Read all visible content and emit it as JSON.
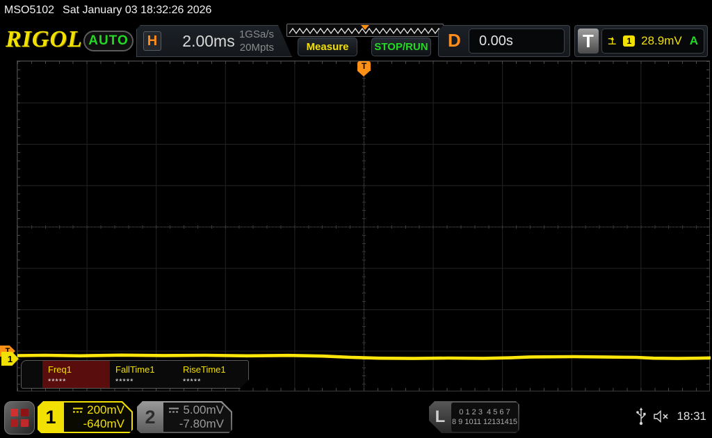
{
  "titlebar": {
    "model": "MSO5102",
    "datetime": "Sat January 03 18:32:26 2026"
  },
  "header": {
    "logo": "RIGOL",
    "auto_badge": "AUTO",
    "h_label": "H",
    "timebase": "2.00ms",
    "sample_rate": "1GSa/s",
    "mem_depth": "20Mpts",
    "measure_button": "Measure",
    "stoprun_button": "STOP/RUN",
    "d_label": "D",
    "delay": "0.00s",
    "t_label": "T",
    "trigger_channel": "1",
    "trigger_level": "28.9mV",
    "trigger_mode": "A"
  },
  "graticule": {
    "trigger_pos_marker": "T",
    "trigger_level_marker": "T",
    "channel1_marker": "1"
  },
  "measurements": {
    "items": [
      {
        "label": "Freq1",
        "value": "*****"
      },
      {
        "label": "FallTime1",
        "value": "*****"
      },
      {
        "label": "RiseTime1",
        "value": "*****"
      }
    ]
  },
  "bottombar": {
    "ch1": {
      "number": "1",
      "scale": "200mV",
      "offset": "-640mV"
    },
    "ch2": {
      "number": "2",
      "scale": "5.00mV",
      "offset": "-7.80mV"
    },
    "logic": {
      "label": "L",
      "row1": "0 1 2 3  4 5 6 7",
      "row2": "8 9 1011 12131415"
    },
    "clock": "18:31"
  },
  "colors": {
    "channel1_yellow": "#f2e003",
    "trace_yellow": "#ffe60a",
    "accent_orange": "#ff8d1e",
    "status_green": "#25d825",
    "selected_meas_bg": "#5a0d0d"
  }
}
